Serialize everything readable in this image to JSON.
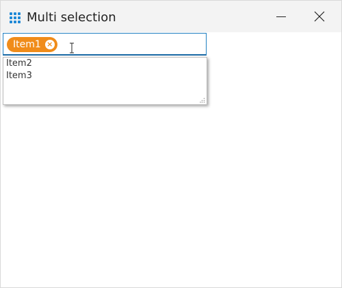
{
  "window": {
    "title": "Multi selection",
    "icons": {
      "app": "app-grid-icon",
      "minimize": "minimize-icon",
      "close": "close-icon"
    },
    "accent_color": "#1e88d6"
  },
  "multiselect": {
    "selected": [
      {
        "label": "Item1",
        "remove_icon": "close-circle-icon"
      }
    ],
    "chip_color": "#f08c1a",
    "dropdown_items": [
      "Item2",
      "Item3"
    ]
  }
}
